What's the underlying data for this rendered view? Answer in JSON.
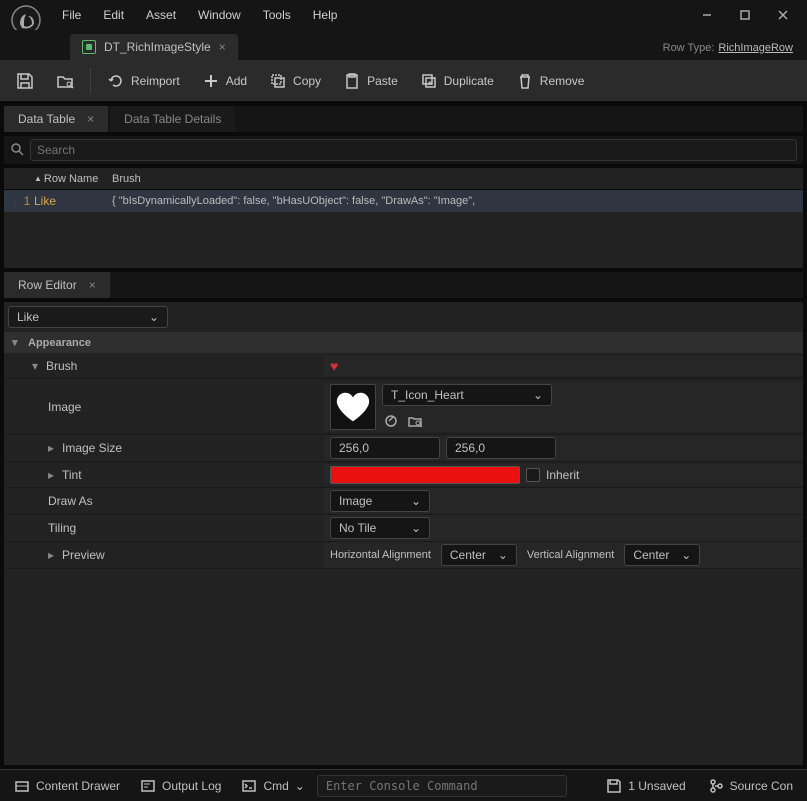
{
  "menu": {
    "file": "File",
    "edit": "Edit",
    "asset": "Asset",
    "window": "Window",
    "tools": "Tools",
    "help": "Help"
  },
  "tab": {
    "name": "DT_RichImageStyle"
  },
  "rowtype": {
    "label": "Row Type:",
    "value": "RichImageRow"
  },
  "toolbar": {
    "reimport": "Reimport",
    "add": "Add",
    "copy": "Copy",
    "paste": "Paste",
    "duplicate": "Duplicate",
    "remove": "Remove"
  },
  "panels": {
    "datatable": "Data Table",
    "details": "Data Table Details",
    "roweditor": "Row Editor"
  },
  "search": {
    "placeholder": "Search"
  },
  "table": {
    "headers": {
      "rowname": "Row Name",
      "brush": "Brush"
    },
    "rows": [
      {
        "num": "1",
        "name": "Like",
        "brush": "{ \"bIsDynamicallyLoaded\": false, \"bHasUObject\": false, \"DrawAs\": \"Image\","
      }
    ]
  },
  "editor": {
    "selected": "Like",
    "appearance": "Appearance",
    "brush": "Brush",
    "image": "Image",
    "imageAsset": "T_Icon_Heart",
    "imageSize": "Image Size",
    "sizeX": "256,0",
    "sizeY": "256,0",
    "tint": "Tint",
    "inherit": "Inherit",
    "drawAs": "Draw As",
    "drawAsVal": "Image",
    "tiling": "Tiling",
    "tilingVal": "No Tile",
    "preview": "Preview",
    "halign": "Horizontal Alignment",
    "halignVal": "Center",
    "valign": "Vertical Alignment",
    "valignVal": "Center"
  },
  "bottom": {
    "contentDrawer": "Content Drawer",
    "outputLog": "Output Log",
    "cmd": "Cmd",
    "cmdPlaceholder": "Enter Console Command",
    "unsaved": "1 Unsaved",
    "source": "Source Con"
  }
}
